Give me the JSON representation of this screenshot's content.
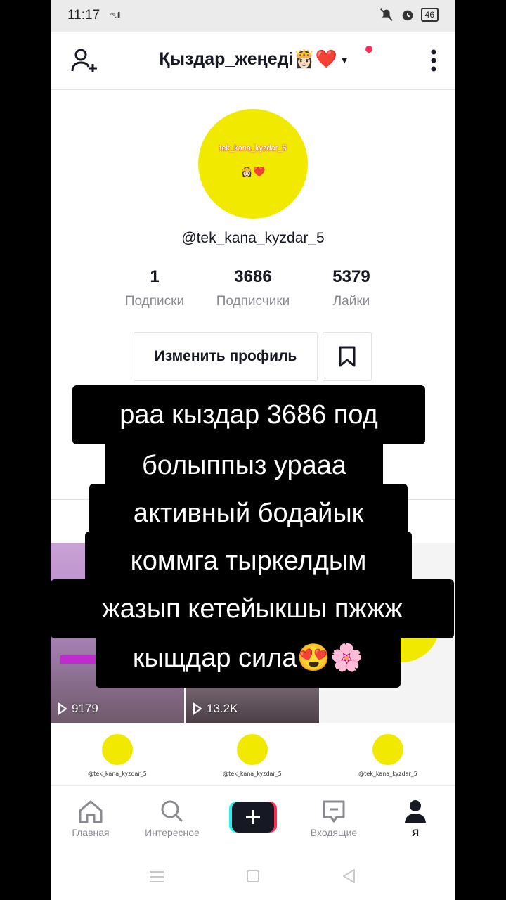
{
  "status_bar": {
    "time": "11:17",
    "signal": "⁴⁶.ıll",
    "battery": "46"
  },
  "header": {
    "title": "Қыздар_жеңеді👸🏻❤️",
    "caret": "▾"
  },
  "profile": {
    "avatar_text": "tek_kana_kyzdar_5",
    "avatar_emoji": "👸🏻❤️",
    "username": "@tek_kana_kyzdar_5",
    "stats": [
      {
        "value": "1",
        "label": "Подписки"
      },
      {
        "value": "3686",
        "label": "Подписчики"
      },
      {
        "value": "5379",
        "label": "Лайки"
      }
    ],
    "edit_button": "Изменить профиль"
  },
  "videos": [
    {
      "views": "9179"
    },
    {
      "views": "13.2K"
    }
  ],
  "thumb_text": {
    "handle": "@tek_kana_kyzdar_5"
  },
  "overlay_lines": [
    "раа кыздар 3686 под",
    "болыппыз урааа",
    "активный бодайык",
    "коммга тыркелдым",
    "жазып кетейыкшы пжжж",
    "кыщдар сила😍🌸"
  ],
  "tabs": [
    {
      "label": "Главная",
      "icon": "home-icon"
    },
    {
      "label": "Интересное",
      "icon": "search-icon"
    },
    {
      "label": "Входящие",
      "icon": "inbox-icon"
    },
    {
      "label": "Я",
      "icon": "profile-icon"
    }
  ],
  "colors": {
    "accent": "#fe2c55",
    "avatar": "#f2e900",
    "plus_cyan": "#25f4ee"
  }
}
